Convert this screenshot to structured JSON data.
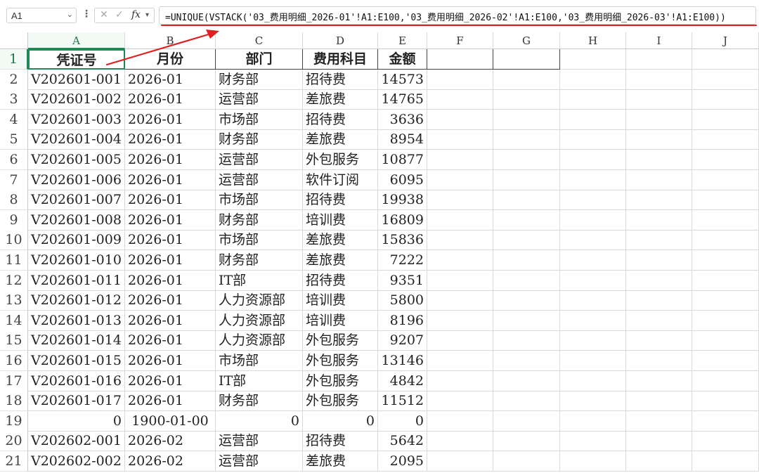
{
  "formula_bar": {
    "name_box": "A1",
    "formula": "=UNIQUE(VSTACK('03_费用明细_2026-01'!A1:E100,'03_费用明细_2026-02'!A1:E100,'03_费用明细_2026-03'!A1:E100))"
  },
  "columns": [
    "A",
    "B",
    "C",
    "D",
    "E",
    "F",
    "G",
    "H",
    "I",
    "J"
  ],
  "rows": [
    "1",
    "2",
    "3",
    "4",
    "5",
    "6",
    "7",
    "8",
    "9",
    "10",
    "11",
    "12",
    "13",
    "14",
    "15",
    "16",
    "17",
    "18",
    "19",
    "20",
    "21"
  ],
  "table": {
    "headers": [
      "凭证号",
      "月份",
      "部门",
      "费用科目",
      "金额"
    ],
    "data": [
      [
        "V202601-001",
        "2026-01",
        "财务部",
        "招待费",
        "14573"
      ],
      [
        "V202601-002",
        "2026-01",
        "运营部",
        "差旅费",
        "14765"
      ],
      [
        "V202601-003",
        "2026-01",
        "市场部",
        "招待费",
        "3636"
      ],
      [
        "V202601-004",
        "2026-01",
        "财务部",
        "差旅费",
        "8954"
      ],
      [
        "V202601-005",
        "2026-01",
        "运营部",
        "外包服务",
        "10877"
      ],
      [
        "V202601-006",
        "2026-01",
        "运营部",
        "软件订阅",
        "6095"
      ],
      [
        "V202601-007",
        "2026-01",
        "市场部",
        "招待费",
        "19938"
      ],
      [
        "V202601-008",
        "2026-01",
        "财务部",
        "培训费",
        "16809"
      ],
      [
        "V202601-009",
        "2026-01",
        "市场部",
        "差旅费",
        "15836"
      ],
      [
        "V202601-010",
        "2026-01",
        "财务部",
        "差旅费",
        "7222"
      ],
      [
        "V202601-011",
        "2026-01",
        "IT部",
        "招待费",
        "9351"
      ],
      [
        "V202601-012",
        "2026-01",
        "人力资源部",
        "培训费",
        "5800"
      ],
      [
        "V202601-013",
        "2026-01",
        "人力资源部",
        "培训费",
        "8196"
      ],
      [
        "V202601-014",
        "2026-01",
        "人力资源部",
        "外包服务",
        "9207"
      ],
      [
        "V202601-015",
        "2026-01",
        "市场部",
        "外包服务",
        "13146"
      ],
      [
        "V202601-016",
        "2026-01",
        "IT部",
        "外包服务",
        "4842"
      ],
      [
        "V202601-017",
        "2026-01",
        "财务部",
        "外包服务",
        "11512"
      ],
      [
        "0",
        "1900-01-00",
        "0",
        "0",
        "0"
      ],
      [
        "V202602-001",
        "2026-02",
        "运营部",
        "招待费",
        "5642"
      ],
      [
        "V202602-002",
        "2026-02",
        "运营部",
        "差旅费",
        "2095"
      ]
    ]
  },
  "colors": {
    "selection_accent": "#1f8a55",
    "annotation_red": "#e02020"
  }
}
